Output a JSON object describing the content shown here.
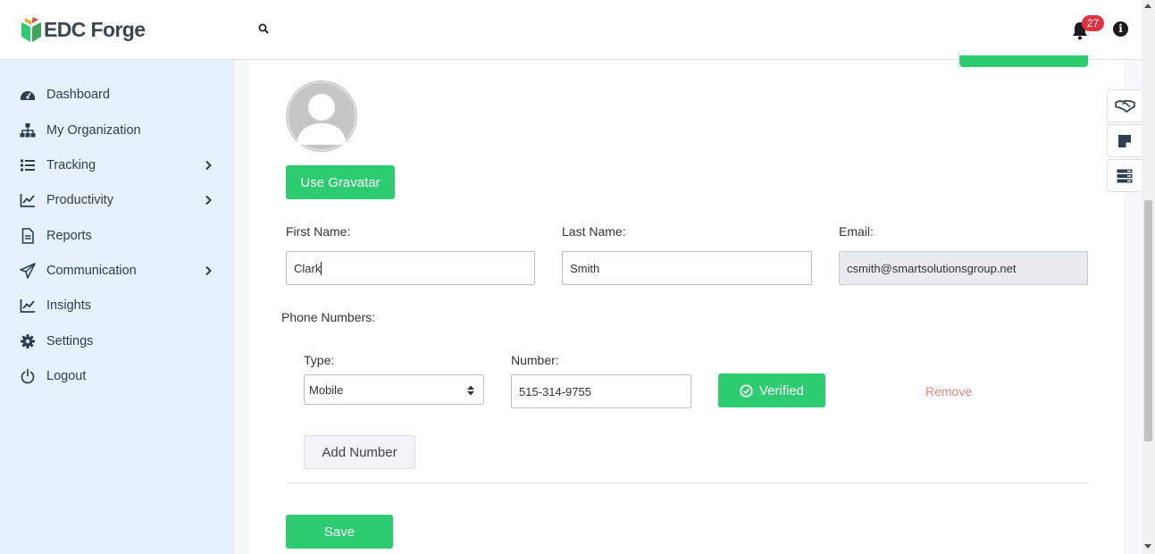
{
  "header": {
    "logo_text": "EDC Forge",
    "notification_count": "27",
    "info_glyph": "i"
  },
  "sidebar": {
    "items": [
      {
        "label": "Dashboard",
        "icon": "dashboard-gauge-icon",
        "has_submenu": false
      },
      {
        "label": "My Organization",
        "icon": "org-chart-icon",
        "has_submenu": false
      },
      {
        "label": "Tracking",
        "icon": "list-icon",
        "has_submenu": true
      },
      {
        "label": "Productivity",
        "icon": "line-chart-icon",
        "has_submenu": true
      },
      {
        "label": "Reports",
        "icon": "document-icon",
        "has_submenu": false
      },
      {
        "label": "Communication",
        "icon": "paper-plane-icon",
        "has_submenu": true
      },
      {
        "label": "Insights",
        "icon": "line-chart-icon",
        "has_submenu": false
      },
      {
        "label": "Settings",
        "icon": "gear-icon",
        "has_submenu": false
      },
      {
        "label": "Logout",
        "icon": "power-icon",
        "has_submenu": false
      }
    ]
  },
  "profile": {
    "gravatar_button": "Use Gravatar",
    "first_name_label": "First Name:",
    "first_name_value": "Clark",
    "last_name_label": "Last Name:",
    "last_name_value": "Smith",
    "email_label": "Email:",
    "email_value": "csmith@smartsolutionsgroup.net",
    "phone_numbers_label": "Phone Numbers:",
    "phone": {
      "type_label": "Type:",
      "type_value": "Mobile",
      "number_label": "Number:",
      "number_value": "515-314-9755",
      "verified_label": "Verified",
      "remove_label": "Remove"
    },
    "add_number_button": "Add Number",
    "save_button": "Save"
  },
  "colors": {
    "primary_green": "#2ecc71",
    "sidebar_bg": "#e6f1fb",
    "badge_red": "#e0313f",
    "remove_red": "#e8857b"
  }
}
